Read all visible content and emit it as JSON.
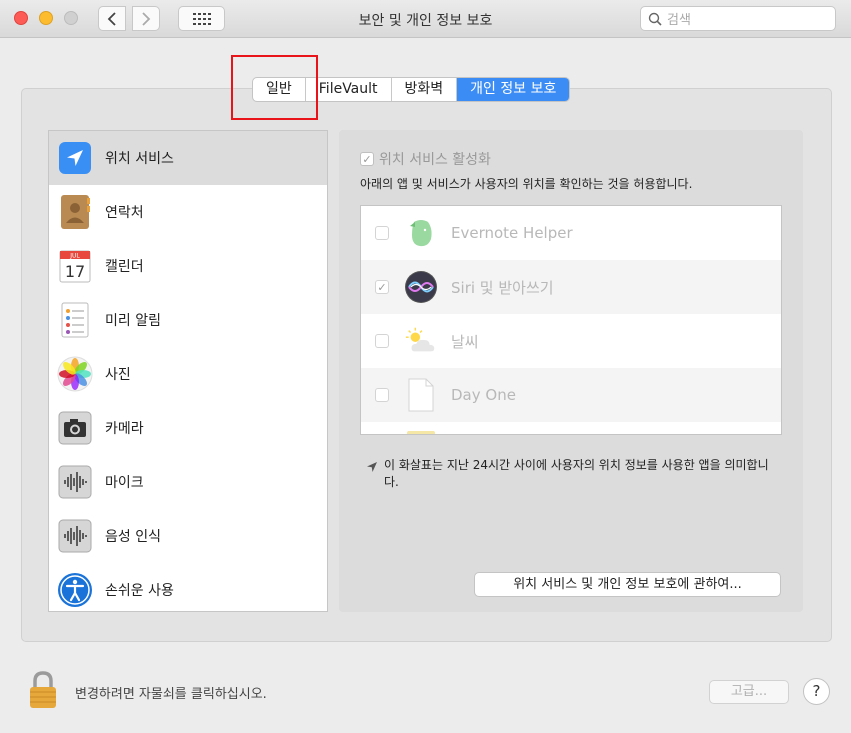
{
  "window": {
    "title": "보안 및 개인 정보 보호",
    "search_placeholder": "검색"
  },
  "tabs": [
    {
      "label": "일반"
    },
    {
      "label": "FileVault"
    },
    {
      "label": "방화벽"
    },
    {
      "label": "개인 정보 보호",
      "active": true
    }
  ],
  "sidebar": {
    "items": [
      {
        "label": "위치 서비스",
        "icon": "location-arrow-icon",
        "selected": true
      },
      {
        "label": "연락처",
        "icon": "contacts-icon"
      },
      {
        "label": "캘린더",
        "icon": "calendar-icon",
        "calendar_month": "JUL",
        "calendar_day": "17"
      },
      {
        "label": "미리 알림",
        "icon": "reminders-icon"
      },
      {
        "label": "사진",
        "icon": "photos-icon"
      },
      {
        "label": "카메라",
        "icon": "camera-icon"
      },
      {
        "label": "마이크",
        "icon": "microphone-icon"
      },
      {
        "label": "음성 인식",
        "icon": "speech-recognition-icon"
      },
      {
        "label": "손쉬운 사용",
        "icon": "accessibility-icon"
      }
    ]
  },
  "location": {
    "enable_label": "위치 서비스 활성화",
    "enable_checked": true,
    "description": "아래의 앱 및 서비스가 사용자의 위치를 확인하는 것을 허용합니다.",
    "apps": [
      {
        "name": "Evernote Helper",
        "checked": false,
        "icon": "evernote-icon"
      },
      {
        "name": "Siri 및 받아쓰기",
        "checked": true,
        "icon": "siri-icon"
      },
      {
        "name": "날씨",
        "checked": false,
        "icon": "weather-icon"
      },
      {
        "name": "Day One",
        "checked": false,
        "icon": "document-icon"
      }
    ],
    "note": "이 화살표는 지난 24시간 사이에 사용자의 위치 정보를 사용한 앱을 의미합니다.",
    "about_button": "위치 서비스 및 개인 정보 보호에 관하여..."
  },
  "footer": {
    "lock_text": "변경하려면 자물쇠를 클릭하십시오.",
    "advanced_button": "고급...",
    "help_button": "?"
  },
  "colors": {
    "accent": "#3c8cf5",
    "highlight_box": "#e8141a"
  }
}
